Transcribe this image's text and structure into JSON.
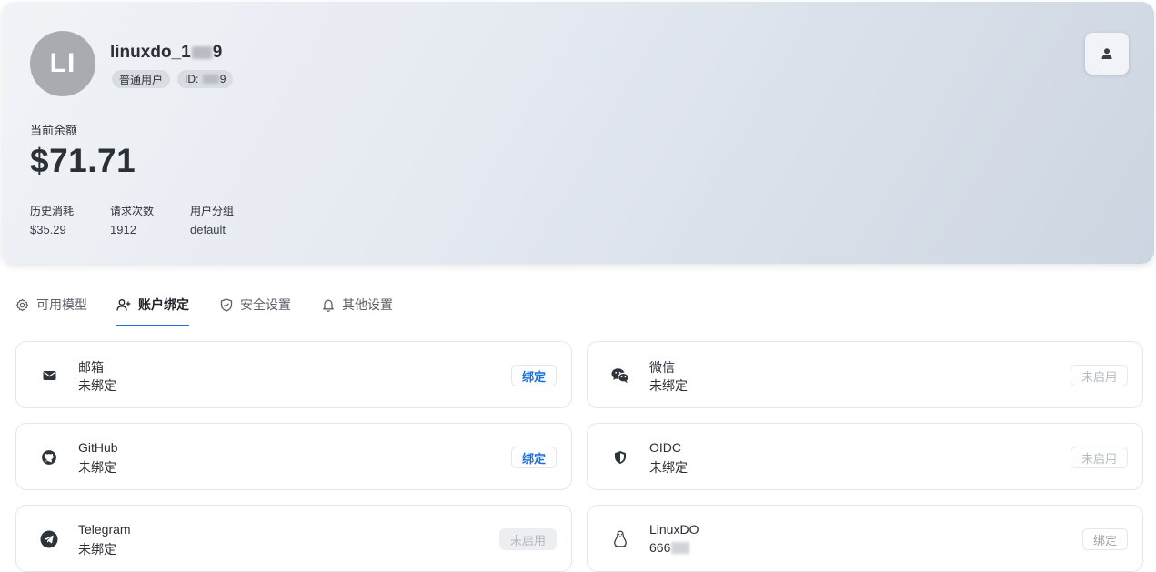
{
  "header": {
    "avatar_initials": "LI",
    "username_prefix": "linuxdo_1",
    "username_suffix": "9",
    "role_tag": "普通用户",
    "id_prefix": "ID: ",
    "id_suffix": "9",
    "balance_label": "当前余额",
    "balance": "$71.71",
    "stats": [
      {
        "label": "历史消耗",
        "value": "$35.29"
      },
      {
        "label": "请求次数",
        "value": "1912"
      },
      {
        "label": "用户分组",
        "value": "default"
      }
    ],
    "profile_button_icon": "user-icon"
  },
  "tabs": [
    {
      "label": "可用模型",
      "icon": "gear-icon"
    },
    {
      "label": "账户绑定",
      "icon": "user-plus-icon",
      "active": true
    },
    {
      "label": "安全设置",
      "icon": "shield-icon"
    },
    {
      "label": "其他设置",
      "icon": "bell-icon"
    }
  ],
  "bindings": [
    {
      "name": "邮箱",
      "status": "未绑定",
      "button": "绑定",
      "icon": "mail-icon"
    },
    {
      "name": "微信",
      "status": "未绑定",
      "button": "未启用",
      "icon": "wechat-icon"
    },
    {
      "name": "GitHub",
      "status": "未绑定",
      "button": "绑定",
      "icon": "github-icon"
    },
    {
      "name": "OIDC",
      "status": "未绑定",
      "button": "未启用",
      "icon": "shield-icon"
    },
    {
      "name": "Telegram",
      "status": "未绑定",
      "button": "未启用",
      "icon": "telegram-icon"
    },
    {
      "name": "LinuxDO",
      "status": "666",
      "button": "绑定",
      "icon": "penguin-icon"
    }
  ],
  "colors": {
    "accent": "#1a6fe0",
    "text": "#2b2f36",
    "disabled": "#b5b9bf"
  }
}
